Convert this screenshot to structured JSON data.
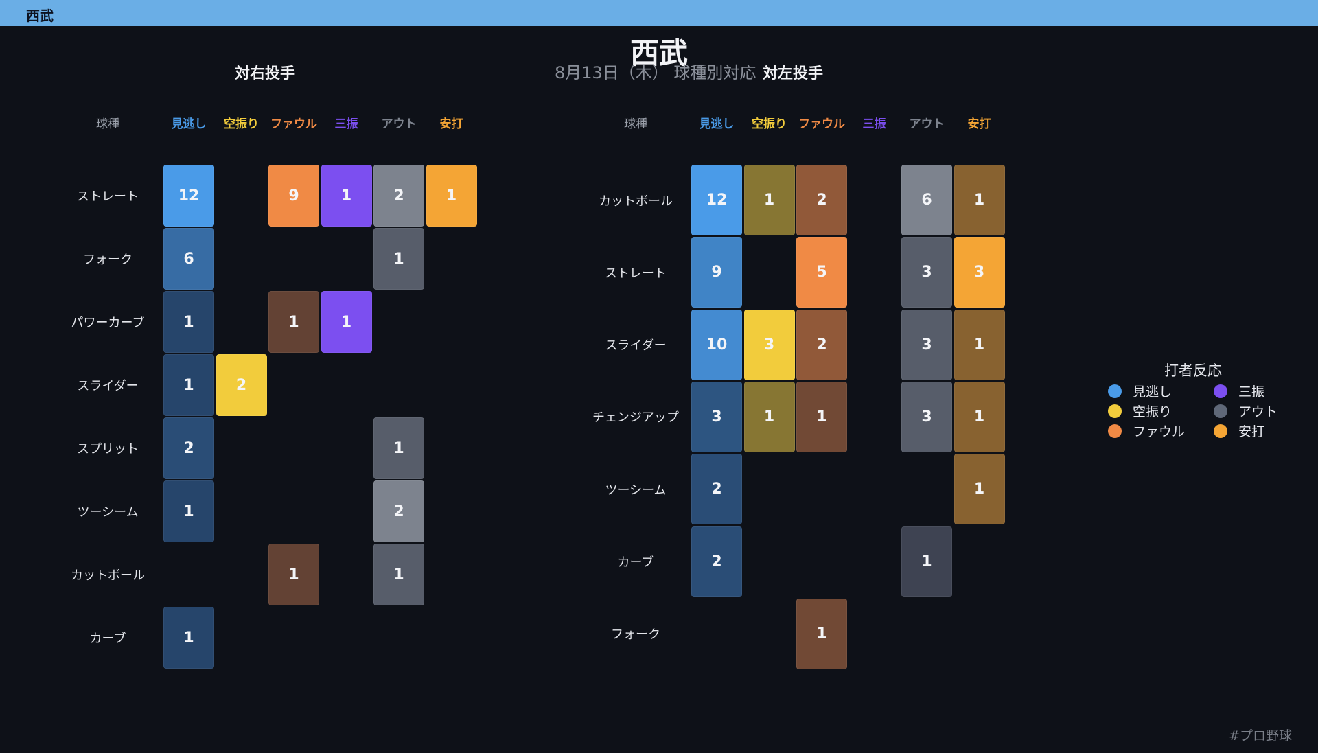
{
  "header": {
    "bar_title": "西武"
  },
  "title": "西武",
  "subtitle": "8月13日（木） 球種別対応",
  "hashtag": "#プロ野球",
  "legend": {
    "title": "打者反応",
    "items": [
      {
        "label": "見逃し",
        "color": "#4a9be8"
      },
      {
        "label": "三振",
        "color": "#7c4ff0"
      },
      {
        "label": "空振り",
        "color": "#f2cc3c"
      },
      {
        "label": "アウト",
        "color": "#5f6878"
      },
      {
        "label": "ファウル",
        "color": "#f08a45"
      },
      {
        "label": "安打",
        "color": "#f4a535"
      }
    ]
  },
  "chart_data": [
    {
      "type": "heatmap",
      "title": "対右投手",
      "corner_label": "球種",
      "columns": [
        {
          "label": "見逃し",
          "color": "#4a9be8"
        },
        {
          "label": "空振り",
          "color": "#f2cc3c"
        },
        {
          "label": "ファウル",
          "color": "#f08a45"
        },
        {
          "label": "三振",
          "color": "#7c4ff0"
        },
        {
          "label": "アウト",
          "color": "#7d838e"
        },
        {
          "label": "安打",
          "color": "#f4a535"
        }
      ],
      "rows": [
        "ストレート",
        "フォーク",
        "パワーカーブ",
        "スライダー",
        "スプリット",
        "ツーシーム",
        "カットボール",
        "カーブ"
      ],
      "values": [
        [
          12,
          0,
          9,
          1,
          2,
          1
        ],
        [
          6,
          0,
          0,
          0,
          1,
          0
        ],
        [
          1,
          0,
          1,
          1,
          0,
          0
        ],
        [
          1,
          2,
          0,
          0,
          0,
          0
        ],
        [
          2,
          0,
          0,
          0,
          1,
          0
        ],
        [
          1,
          0,
          0,
          0,
          2,
          0
        ],
        [
          0,
          0,
          1,
          0,
          1,
          0
        ],
        [
          1,
          0,
          0,
          0,
          0,
          0
        ]
      ]
    },
    {
      "type": "heatmap",
      "title": "対左投手",
      "corner_label": "球種",
      "columns": [
        {
          "label": "見逃し",
          "color": "#4a9be8"
        },
        {
          "label": "空振り",
          "color": "#f2cc3c"
        },
        {
          "label": "ファウル",
          "color": "#f08a45"
        },
        {
          "label": "三振",
          "color": "#7c4ff0"
        },
        {
          "label": "アウト",
          "color": "#7d838e"
        },
        {
          "label": "安打",
          "color": "#f4a535"
        }
      ],
      "rows": [
        "カットボール",
        "ストレート",
        "スライダー",
        "チェンジアップ",
        "ツーシーム",
        "カーブ",
        "フォーク"
      ],
      "values": [
        [
          12,
          1,
          2,
          0,
          6,
          1
        ],
        [
          9,
          0,
          5,
          0,
          3,
          3
        ],
        [
          10,
          3,
          2,
          0,
          3,
          1
        ],
        [
          3,
          1,
          1,
          0,
          3,
          1
        ],
        [
          2,
          0,
          0,
          0,
          0,
          1
        ],
        [
          2,
          0,
          0,
          0,
          1,
          0
        ],
        [
          0,
          0,
          1,
          0,
          0,
          0
        ]
      ]
    }
  ]
}
